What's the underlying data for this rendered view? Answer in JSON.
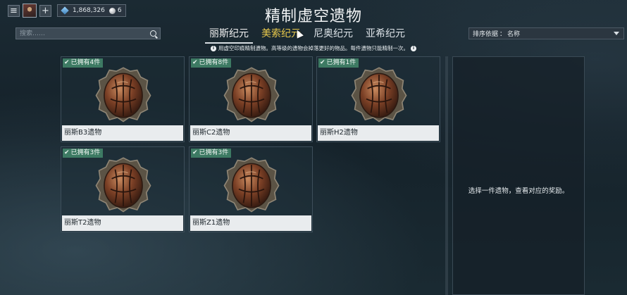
{
  "hud": {
    "menu_icon": "hamburger-menu-icon",
    "add_icon": "plus-icon",
    "platinum": "1,868,326",
    "credits": "6"
  },
  "title": "精制虚空遗物",
  "search": {
    "placeholder": "搜索……"
  },
  "tabs": [
    {
      "label": "丽斯纪元",
      "active": true
    },
    {
      "label": "美索纪元",
      "active": false
    },
    {
      "label": "尼奥纪元",
      "active": false
    },
    {
      "label": "亚希纪元",
      "active": false
    }
  ],
  "sort": {
    "label": "排序依据",
    "value": "名称"
  },
  "info_text": "用虚空印痕精制遗物。高等级的遗物会掉落更好的物品。每件遗物只能精制一次。",
  "relics": [
    {
      "badge": "已拥有4件",
      "name": "丽斯B3遗物"
    },
    {
      "badge": "已拥有8件",
      "name": "丽斯C2遗物"
    },
    {
      "badge": "已拥有1件",
      "name": "丽斯H2遗物"
    },
    {
      "badge": "已拥有3件",
      "name": "丽斯T2遗物"
    },
    {
      "badge": "已拥有3件",
      "name": "丽斯Z1遗物"
    }
  ],
  "detail": {
    "prompt": "选择一件遗物，查看对应的奖励。"
  },
  "colors": {
    "badge_green": "#3d7a63",
    "hover_gold": "#e9c94b"
  }
}
